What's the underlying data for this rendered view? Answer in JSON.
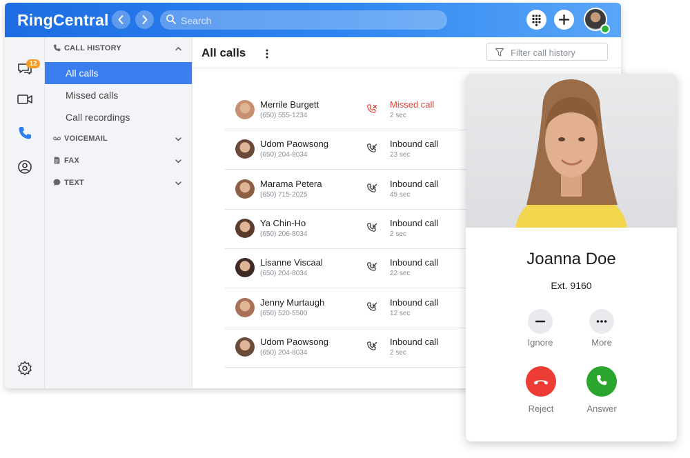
{
  "header": {
    "logo": "RingCentral",
    "back_icon": "chevron-left-icon",
    "forward_icon": "chevron-right-icon",
    "search_placeholder": "Search",
    "dialpad_icon": "dialpad-icon",
    "add_icon": "plus-icon",
    "accent": "#1d6ce3",
    "presence_color": "#27b33a"
  },
  "leftbar": {
    "messages_badge": "12",
    "icons": [
      "messages-icon",
      "video-icon",
      "phone-icon",
      "contacts-icon",
      "settings-icon"
    ]
  },
  "sidenav": {
    "call_history": "CALL HISTORY",
    "items": [
      {
        "label": "All calls",
        "active": true
      },
      {
        "label": "Missed calls",
        "active": false
      },
      {
        "label": "Call recordings",
        "active": false
      }
    ],
    "voicemail": "VOICEMAIL",
    "fax": "FAX",
    "text": "TEXT"
  },
  "main": {
    "title": "All calls",
    "filter_placeholder": "Filter call history",
    "calls": [
      {
        "name": "Merrile Burgett",
        "phone": "(650) 555-1234",
        "type": "Missed call",
        "duration": "2 sec",
        "missed": true
      },
      {
        "name": "Udom Paowsong",
        "phone": "(650) 204-8034",
        "type": "Inbound call",
        "duration": "23 sec",
        "missed": false
      },
      {
        "name": "Marama Petera",
        "phone": "(650) 715-2025",
        "type": "Inbound call",
        "duration": "45 sec",
        "missed": false
      },
      {
        "name": "Ya Chin-Ho",
        "phone": "(650) 206-8034",
        "type": "Inbound call",
        "duration": "2 sec",
        "missed": false
      },
      {
        "name": "Lisanne Viscaal",
        "phone": "(650) 204-8034",
        "type": "Inbound call",
        "duration": "22 sec",
        "missed": false
      },
      {
        "name": "Jenny Murtaugh",
        "phone": "(650) 520-5500",
        "type": "Inbound call",
        "duration": "12 sec",
        "missed": false
      },
      {
        "name": "Udom Paowsong",
        "phone": "(650) 204-8034",
        "type": "Inbound call",
        "duration": "2 sec",
        "missed": false
      }
    ]
  },
  "incoming": {
    "name": "Joanna Doe",
    "ext": "Ext. 9160",
    "ignore": "Ignore",
    "more": "More",
    "reject": "Reject",
    "answer": "Answer",
    "reject_color": "#ec3c33",
    "answer_color": "#2aa52e"
  }
}
